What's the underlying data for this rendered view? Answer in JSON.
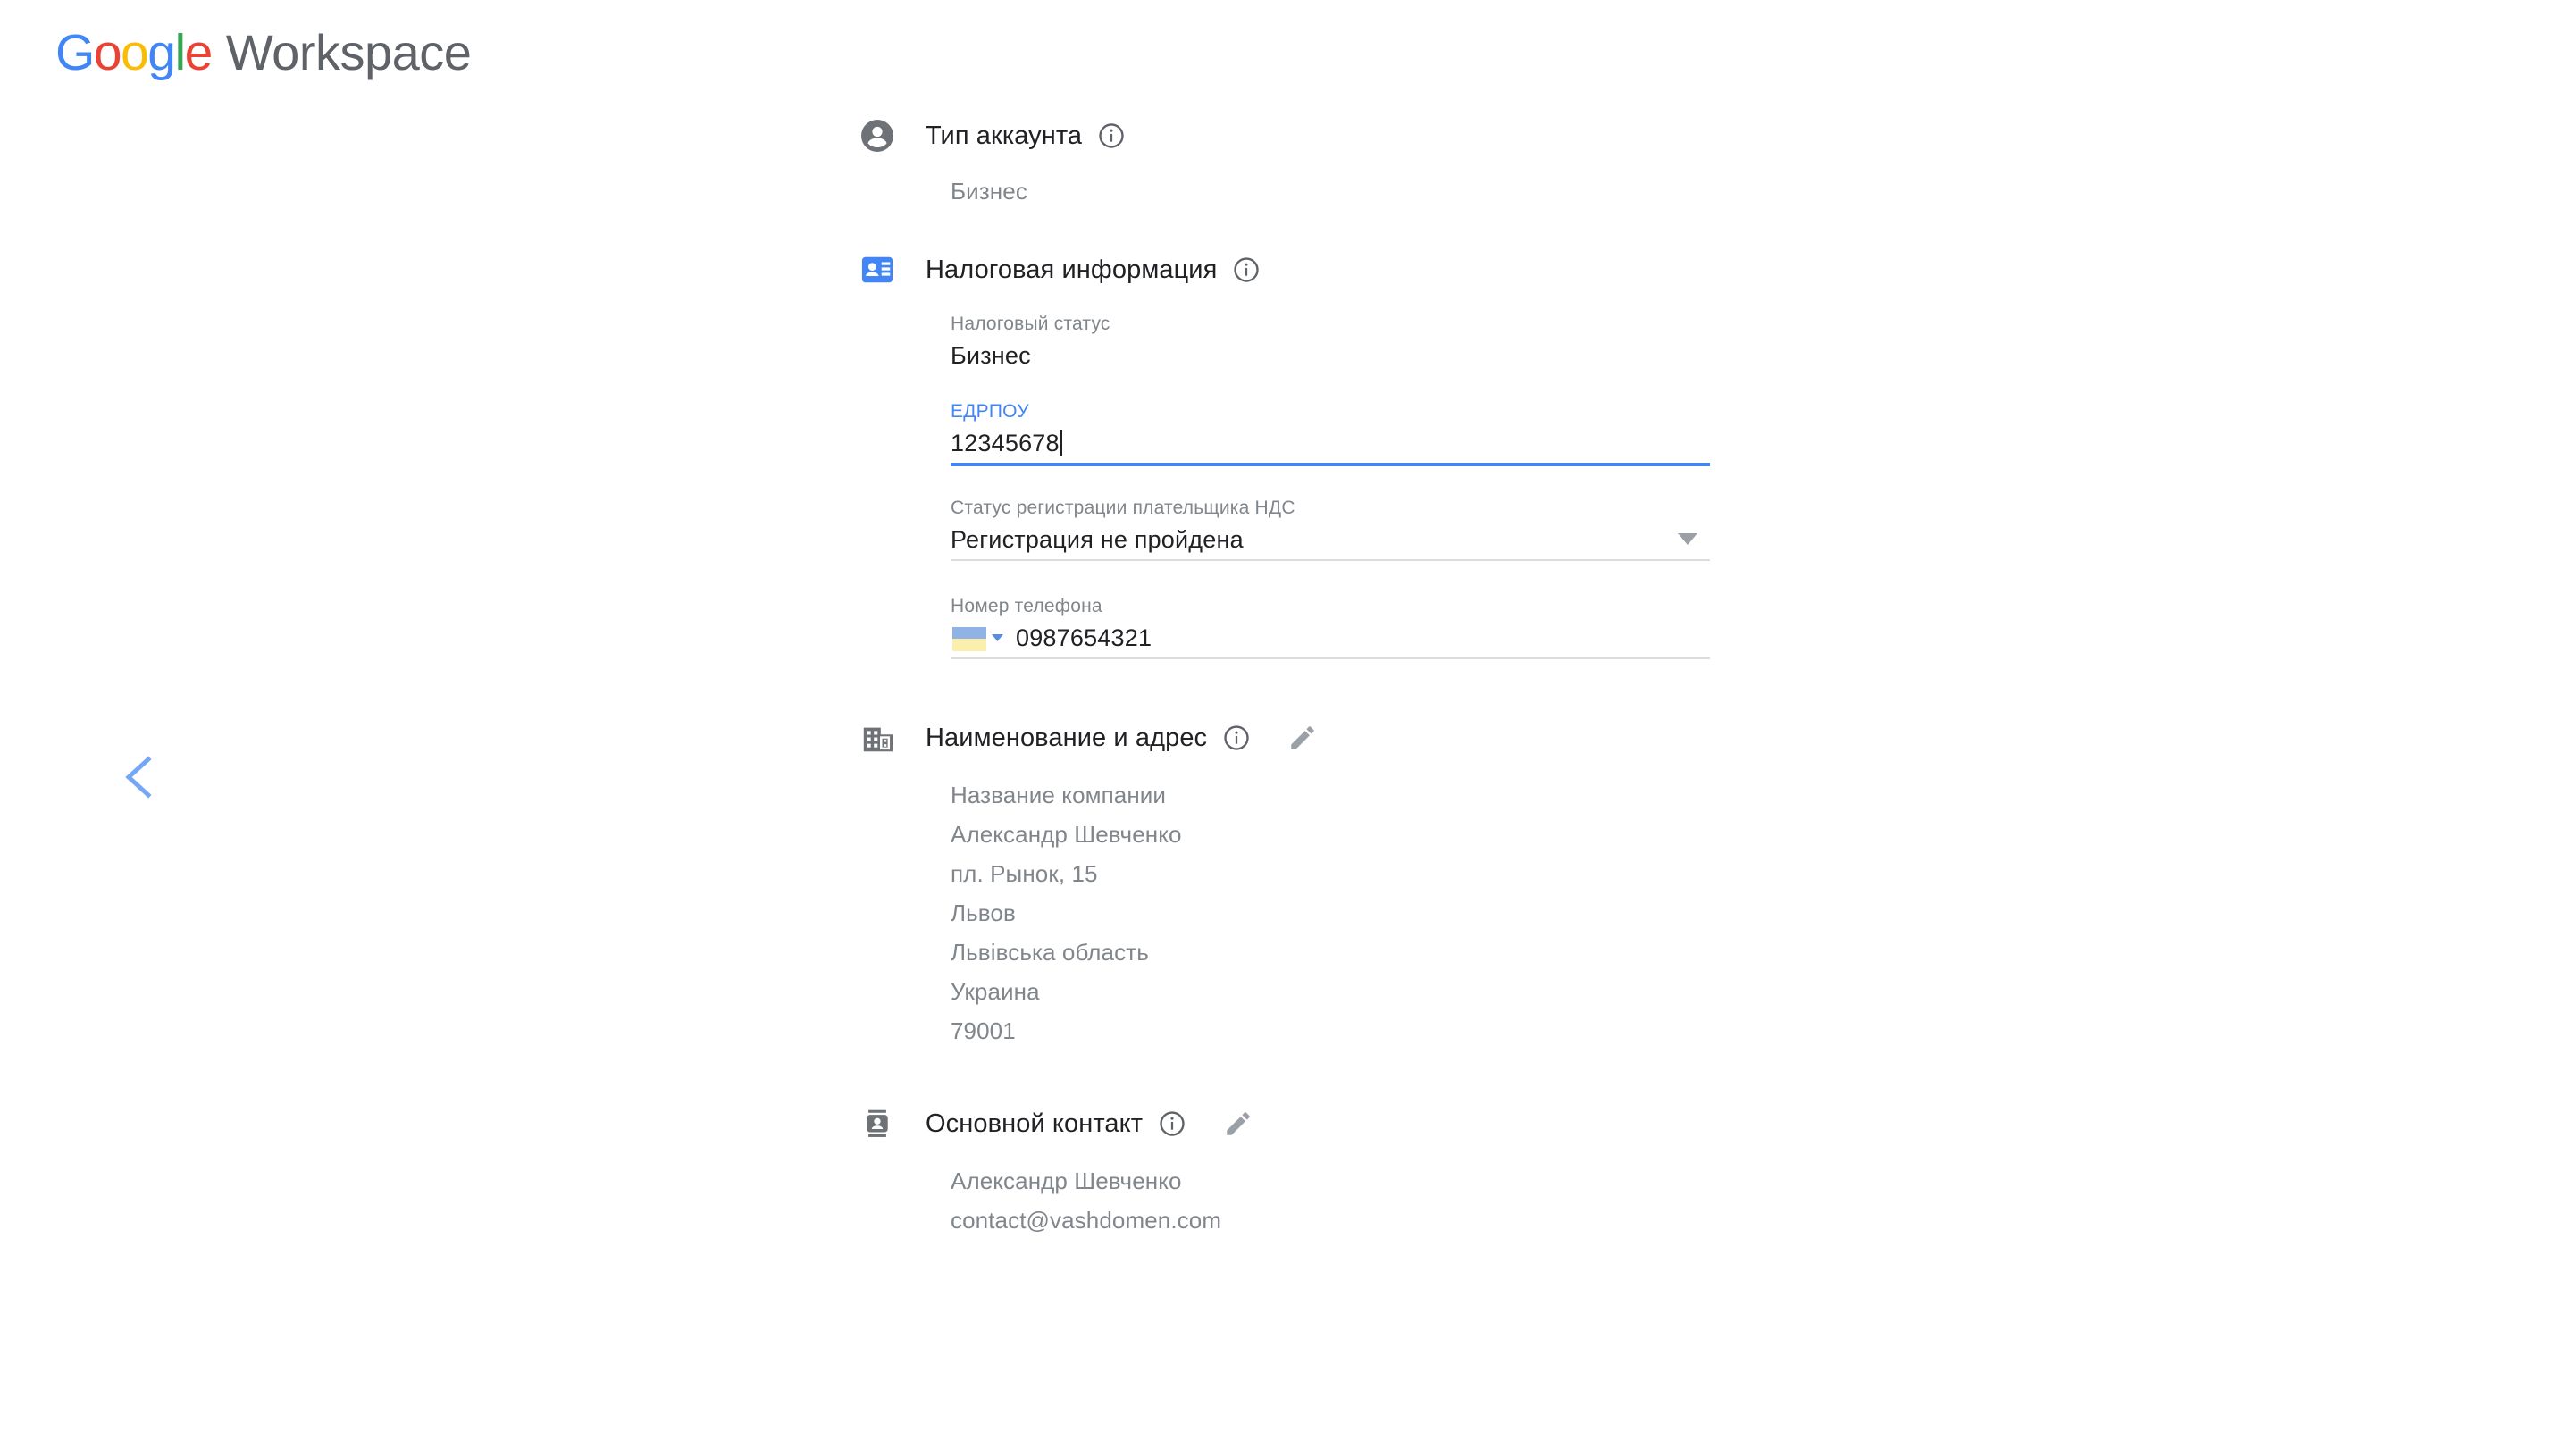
{
  "brand": {
    "google_letters": [
      "G",
      "o",
      "o",
      "g",
      "l",
      "e"
    ],
    "workspace": "Workspace",
    "colors": {
      "blue": "#4285f4",
      "red": "#ea4335",
      "yellow": "#fbbc05",
      "green": "#34a853",
      "gray": "#5f6368"
    }
  },
  "nav": {
    "back_icon": "chevron-left-icon",
    "back_color": "#76a7f7"
  },
  "sections": {
    "account_type": {
      "icon": "account-circle-icon",
      "title": "Тип аккаунта",
      "info_icon": "info-icon",
      "value": "Бизнес"
    },
    "tax_info": {
      "icon": "contact-card-icon",
      "icon_color": "#4285f4",
      "title": "Налоговая информация",
      "info_icon": "info-icon",
      "tax_status": {
        "label": "Налоговый статус",
        "value": "Бизнес"
      },
      "edrpou": {
        "label": "ЕДРПОУ",
        "value": "12345678",
        "focused": true
      },
      "vat_status": {
        "label": "Статус регистрации плательщика НДС",
        "value": "Регистрация не пройдена",
        "arrow_icon": "dropdown-triangle-icon"
      },
      "phone": {
        "label": "Номер телефона",
        "flag_icon": "ukraine-flag-icon",
        "flag_arrow_icon": "dropdown-triangle-icon",
        "value": "0987654321"
      }
    },
    "name_address": {
      "icon": "building-icon",
      "title": "Наименование и адрес",
      "info_icon": "info-icon",
      "edit_icon": "pencil-icon",
      "lines": [
        "Название компании",
        "Александр Шевченко",
        "пл. Рынок, 15",
        "Львов",
        "Львівська область",
        "Украина",
        "79001"
      ]
    },
    "primary_contact": {
      "icon": "contact-badge-icon",
      "title": "Основной контакт",
      "info_icon": "info-icon",
      "edit_icon": "pencil-icon",
      "lines": [
        "Александр Шевченко",
        "contact@vashdomen.com"
      ]
    }
  }
}
